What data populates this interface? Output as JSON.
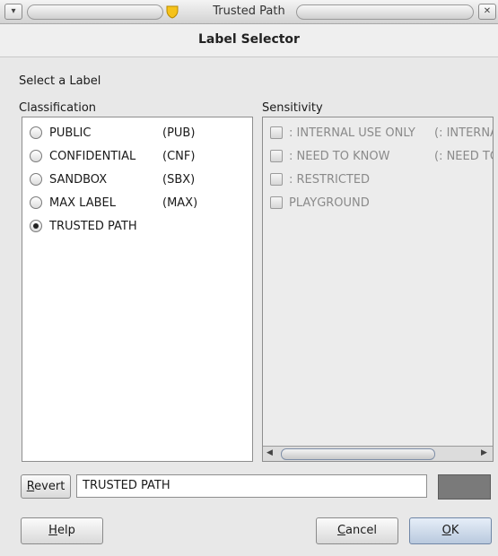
{
  "window": {
    "title": "Trusted Path",
    "menu_glyph": "▾",
    "close_glyph": "✕"
  },
  "dialog": {
    "header": "Label Selector",
    "prompt": "Select a Label"
  },
  "classification": {
    "heading": "Classification",
    "items": [
      {
        "name": "PUBLIC",
        "code": "(PUB)",
        "selected": false
      },
      {
        "name": "CONFIDENTIAL",
        "code": "(CNF)",
        "selected": false
      },
      {
        "name": "SANDBOX",
        "code": "(SBX)",
        "selected": false
      },
      {
        "name": "MAX LABEL",
        "code": "(MAX)",
        "selected": false
      },
      {
        "name": "TRUSTED PATH",
        "code": "",
        "selected": true
      }
    ]
  },
  "sensitivity": {
    "heading": "Sensitivity",
    "items": [
      {
        "name": ": INTERNAL USE ONLY",
        "code": "(: INTERNA"
      },
      {
        "name": ": NEED TO KNOW",
        "code": "(: NEED TO"
      },
      {
        "name": ": RESTRICTED",
        "code": ""
      },
      {
        "name": "PLAYGROUND",
        "code": ""
      }
    ],
    "scroll_left": "◀",
    "scroll_right": "▶"
  },
  "footer": {
    "revert_prefix": "",
    "revert_mnemonic": "R",
    "revert_rest": "evert",
    "label_value": "TRUSTED PATH",
    "swatch_color": "#7a7a7a"
  },
  "buttons": {
    "help_mnemonic": "H",
    "help_rest": "elp",
    "cancel_mnemonic": "C",
    "cancel_rest": "ancel",
    "ok_mnemonic": "O",
    "ok_rest": "K"
  }
}
